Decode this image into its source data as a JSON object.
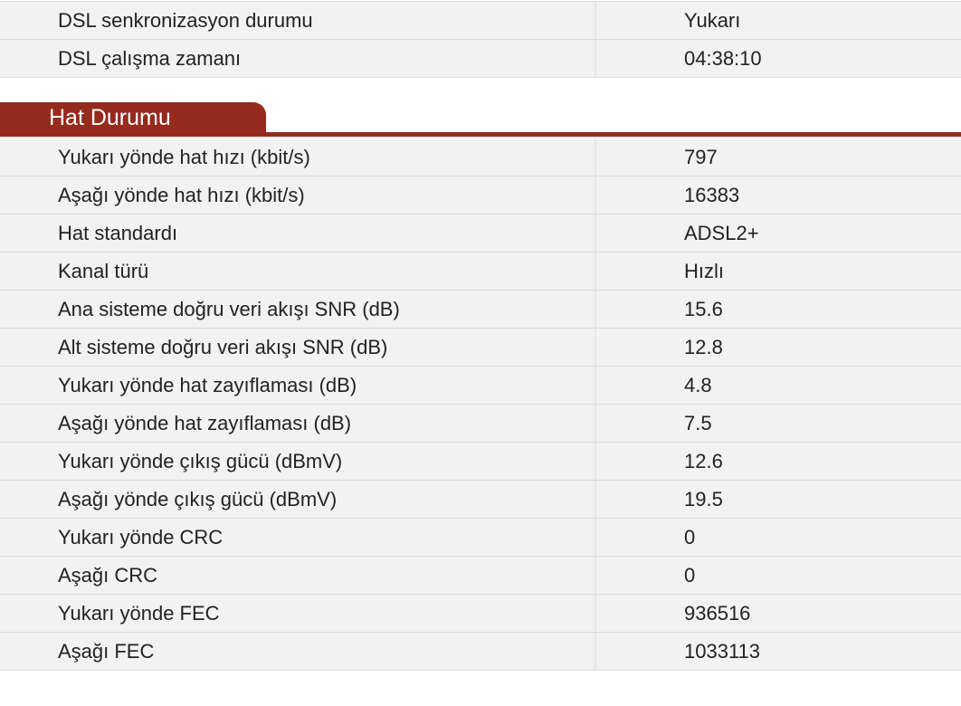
{
  "dsl_status": {
    "rows": [
      {
        "label": "DSL senkronizasyon durumu",
        "value": "Yukarı"
      },
      {
        "label": "DSL çalışma zamanı",
        "value": "04:38:10"
      }
    ]
  },
  "hat_durumu": {
    "title": "Hat Durumu",
    "accent_color": "#962a1d",
    "rows": [
      {
        "label": "Yukarı yönde hat hızı (kbit/s)",
        "value": "797"
      },
      {
        "label": "Aşağı yönde hat hızı (kbit/s)",
        "value": "16383"
      },
      {
        "label": "Hat standardı",
        "value": "ADSL2+"
      },
      {
        "label": "Kanal türü",
        "value": "Hızlı"
      },
      {
        "label": "Ana sisteme doğru veri akışı SNR (dB)",
        "value": "15.6"
      },
      {
        "label": "Alt sisteme doğru veri akışı SNR (dB)",
        "value": "12.8"
      },
      {
        "label": "Yukarı yönde hat zayıflaması (dB)",
        "value": "4.8"
      },
      {
        "label": "Aşağı yönde hat zayıflaması (dB)",
        "value": "7.5"
      },
      {
        "label": "Yukarı yönde çıkış gücü (dBmV)",
        "value": "12.6"
      },
      {
        "label": "Aşağı yönde çıkış gücü (dBmV)",
        "value": "19.5"
      },
      {
        "label": "Yukarı yönde CRC",
        "value": "0"
      },
      {
        "label": "Aşağı CRC",
        "value": "0"
      },
      {
        "label": "Yukarı yönde FEC",
        "value": "936516"
      },
      {
        "label": "Aşağı FEC",
        "value": "1033113"
      }
    ]
  }
}
